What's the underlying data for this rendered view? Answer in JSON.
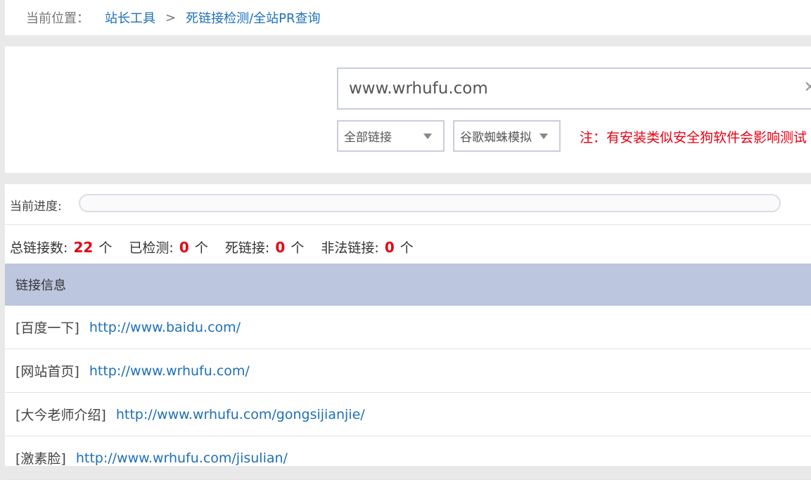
{
  "breadcrumb": {
    "label": "当前位置：",
    "items": [
      "站长工具",
      "死链接检测/全站PR查询"
    ],
    "separator": ">"
  },
  "tool": {
    "url_value": "www.wrhufu.com",
    "clear_icon": "close-icon",
    "select_links": "全部链接",
    "select_spider": "谷歌蜘蛛模拟",
    "note": "注：有安装类似安全狗软件会影响测试"
  },
  "progress": {
    "label": "当前进度:",
    "value": 0
  },
  "stats": {
    "total_label": "总链接数:",
    "total": "22",
    "checked_label": "已检测:",
    "checked": "0",
    "dead_label": "死链接:",
    "dead": "0",
    "illegal_label": "非法链接:",
    "illegal": "0",
    "unit": "个"
  },
  "table": {
    "header": "链接信息",
    "rows": [
      {
        "title": "[百度一下]",
        "url": "http://www.baidu.com/"
      },
      {
        "title": "[网站首页]",
        "url": "http://www.wrhufu.com/"
      },
      {
        "title": "[大今老师介绍]",
        "url": "http://www.wrhufu.com/gongsijianjie/"
      },
      {
        "title": "[激素脸]",
        "url": "http://www.wrhufu.com/jisulian/"
      }
    ]
  },
  "colors": {
    "link": "#1d6fba",
    "accent_red": "#e60012",
    "table_header": "#bcc6de"
  }
}
